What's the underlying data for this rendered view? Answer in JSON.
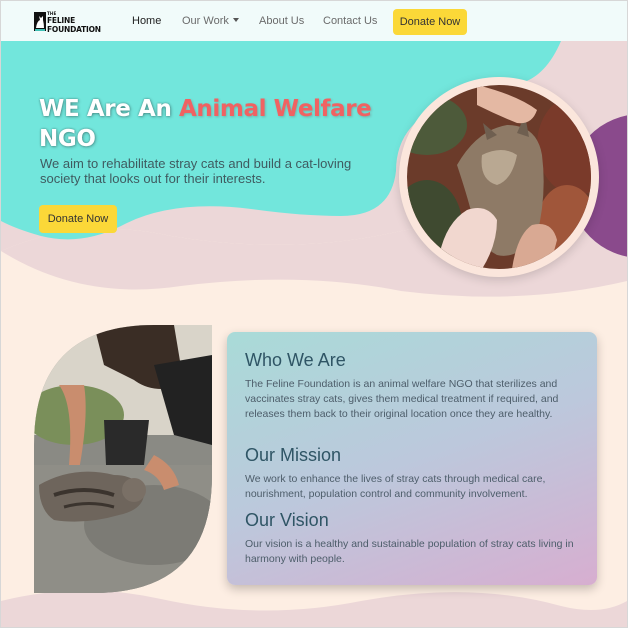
{
  "logo": {
    "small": "THE",
    "line1": "FELINE",
    "line2": "FOUNDATION"
  },
  "nav": {
    "home": "Home",
    "our_work": "Our Work",
    "about": "About Us",
    "contact": "Contact Us",
    "donate": "Donate Now"
  },
  "hero": {
    "title_plain": "WE Are An ",
    "title_accent": "Animal Welfare",
    "title_end": "NGO",
    "subtitle": "We aim to rehabilitate stray cats and build a cat-loving society that looks out for their interests.",
    "donate": "Donate Now"
  },
  "about": {
    "who_title": "Who We Are",
    "who_text": "The Feline Foundation is an animal welfare NGO that sterilizes and vaccinates stray cats, gives them medical treatment if required, and releases them back to their original location once they are healthy.",
    "mission_title": "Our Mission",
    "mission_text": "We work to enhance the lives of stray cats through medical care, nourishment, population control and community involvement.",
    "vision_title": "Our Vision",
    "vision_text": "Our vision is a healthy and sustainable population of stray cats living in harmony with people."
  },
  "colors": {
    "teal": "#72e6dc",
    "peach": "#fdeee3",
    "pink": "#ecd7d8",
    "purple": "#8a4a8c",
    "yellow": "#fbd838",
    "accent_red": "#f06262"
  },
  "icons": [
    "cat-logo-icon",
    "chevron-down-icon"
  ]
}
